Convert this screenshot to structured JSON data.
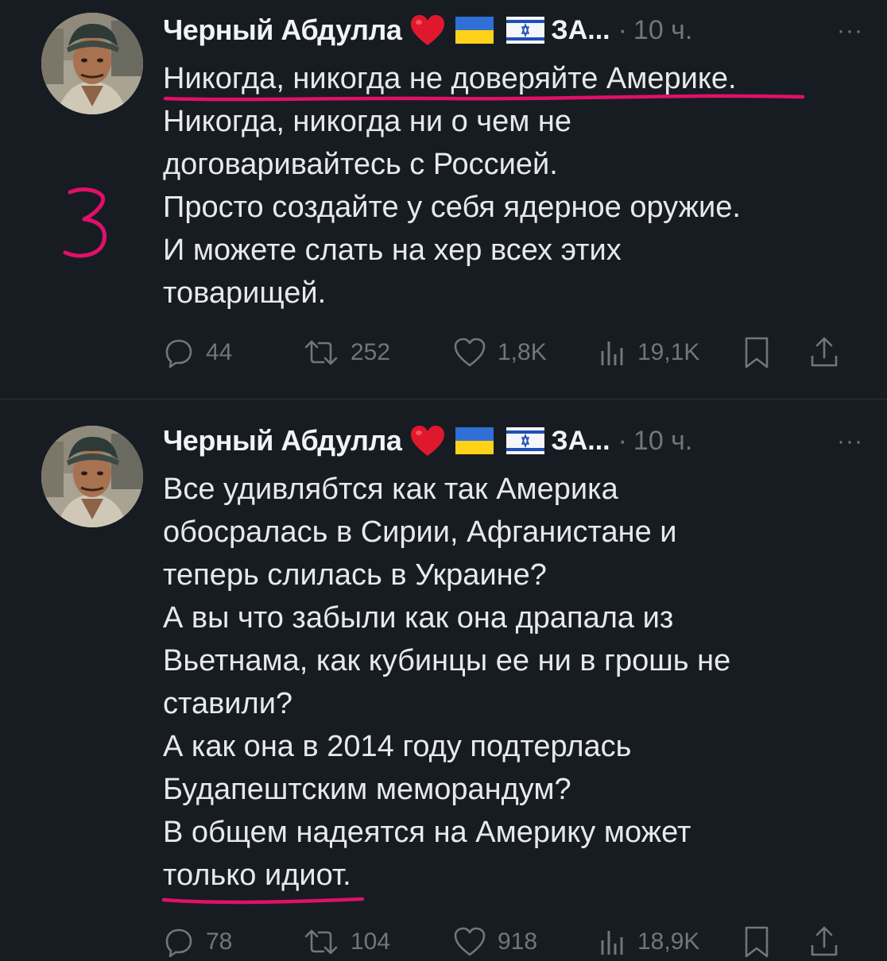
{
  "tweets": [
    {
      "author": "Черный Абдулла",
      "handle_truncated": "ЗА...",
      "separator": "·",
      "time": "10 ч.",
      "more": "···",
      "lines": [
        "Никогда, никогда не доверяйте Америке.",
        "Никогда, никогда ни о чем не",
        "договаривайтесь с Россией.",
        "Просто создайте у себя ядерное оружие.",
        "И можете слать на хер всех этих",
        "товарищей."
      ],
      "replies": "44",
      "retweets": "252",
      "likes": "1,8K",
      "views": "19,1K"
    },
    {
      "author": "Черный Абдулла",
      "handle_truncated": "ЗА...",
      "separator": "·",
      "time": "10 ч.",
      "more": "···",
      "lines": [
        "Все удивлябтся как так Америка",
        "обосралась в Сирии, Афганистане и",
        "теперь слилась в Украине?",
        "А вы что забыли как она драпала из",
        "Вьетнама, как кубинцы ее ни в грошь не",
        "ставили?",
        "А как она в 2014 году подтерлась",
        "Будапештским меморандум?",
        "В общем надеятся на Америку  может",
        "только идиот."
      ],
      "replies": "78",
      "retweets": "104",
      "likes": "918",
      "views": "18,9K"
    }
  ],
  "annotation": {
    "number": "3",
    "color": "#e0106a"
  },
  "colors": {
    "background": "#171c23",
    "text": "#e7e9ea",
    "muted": "#71767b",
    "heart": "#e0182d",
    "ua_blue": "#2f6fd6",
    "ua_yellow": "#ffd21a",
    "il_blue": "#1f4fb4"
  }
}
